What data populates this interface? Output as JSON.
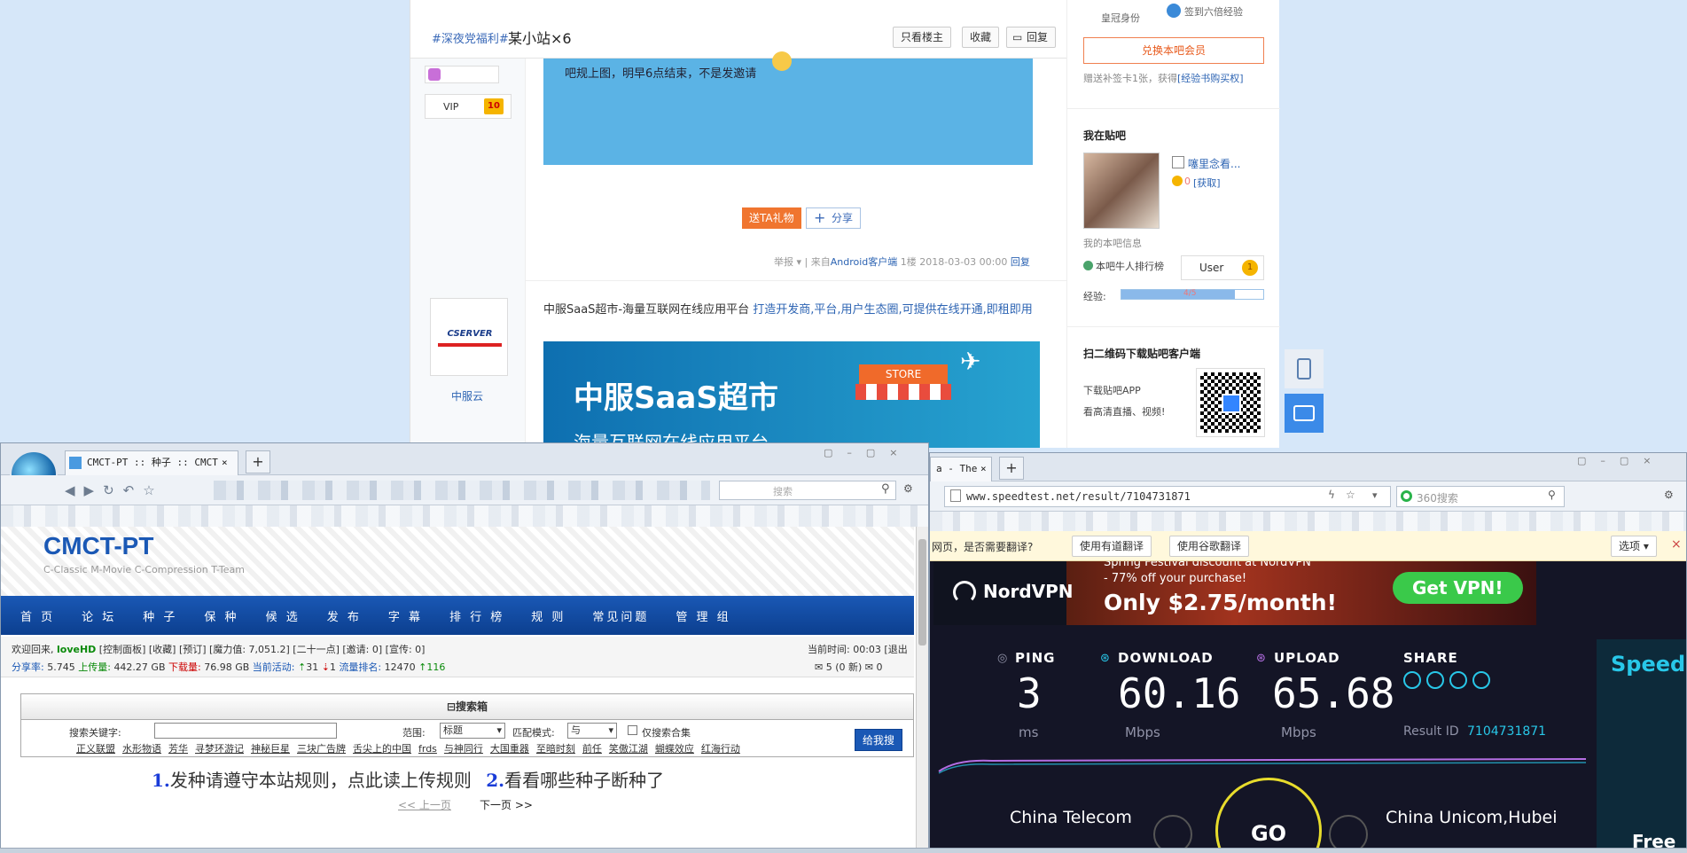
{
  "tieba": {
    "post": {
      "tag": "#深夜党福利#",
      "title": "某小站×6",
      "btn_louzhu": "只看楼主",
      "btn_fav": "收藏",
      "btn_reply": "回复",
      "vip_label": "VIP",
      "vip_level": "10",
      "image_text": "吧规上图，明早6点结束，不是发邀请",
      "gift_btn": "送TA礼物",
      "share_btn": "分享",
      "meta_report": "举报",
      "meta_from": "| 来自",
      "meta_client": "Android客户端",
      "meta_floor": "1楼",
      "meta_time": "2018-03-03 00:00",
      "meta_reply": "回复"
    },
    "ad": {
      "author": "中服云",
      "logo_text": "CSERVER",
      "text_plain": "中服SaaS超市-海量互联网在线应用平台 ",
      "text_link": "打造开发商,平台,用户生态圈,可提供在线开通,即租即用",
      "banner_title": "中服SaaS超市",
      "banner_sub": "海量互联网在线应用平台",
      "store": "STORE"
    },
    "side": {
      "role": "皇冠身份",
      "sign": "签到六倍经验",
      "member_btn": "兑换本吧会员",
      "card_text": "赠送补签卡1张，获得",
      "card_link": "[经验书购买权]",
      "my_title": "我在贴吧",
      "username": "噻里念看...",
      "tbean": "0",
      "tbean_link": "[获取]",
      "my_info": "我的本吧信息",
      "rank_label": "本吧牛人排行榜",
      "rank_user": "User",
      "rank_num": "1",
      "exp_label": "经验:",
      "exp_value": "4/5",
      "exp_fraction": 0.8,
      "qr_title": "扫二维码下载贴吧客户端",
      "qr_line1": "下载贴吧APP",
      "qr_line2": "看高清直播、视频!"
    }
  },
  "cmct": {
    "tab_title": "CMCT-PT :: 种子 :: CMCT",
    "tab_close": "×",
    "new_tab": "+",
    "search_placeholder": "搜索",
    "logo": "CMCT-PT",
    "slogan": "C-Classic M-Movie C-Compression T-Team",
    "nav": [
      "首 页",
      "论 坛",
      "种 子",
      "保 种",
      "候 选",
      "发 布",
      "字 幕",
      "排 行 榜",
      "规 则",
      "常见问题",
      "管 理 组"
    ],
    "welcome": "欢迎回来, ",
    "user": "loveHD",
    "welcome_rest": " [控制面板] [收藏] [预订] [魔力值: 7,051.2] [二十一点] [邀请: 0] [宣传: 0]",
    "time": "当前时间: 00:03 [退出",
    "ratio_label": "分享率:",
    "ratio": "5.745",
    "up_label": "上传量:",
    "up": "442.27 GB",
    "down_label": "下载量:",
    "down": "76.98 GB",
    "active_label": "当前活动:",
    "active_up": "31",
    "active_down": "1",
    "rank_label": "流量排名:",
    "rank": "12470",
    "rank_delta": "116",
    "msg": "5 (0 新)",
    "msg2": "0",
    "searchbox_title": "搜索箱",
    "kw_label": "搜索关键字:",
    "scope_label": "范围:",
    "scope": "标题",
    "mode_label": "匹配模式:",
    "mode": "与",
    "only_collection": "仅搜索合集",
    "search_btn": "给我搜",
    "tags": [
      "正义联盟",
      "水形物语",
      "芳华",
      "寻梦环游记",
      "神秘巨星",
      "三块广告牌",
      "舌尖上的中国",
      "frds",
      "与神同行",
      "大国重器",
      "至暗时刻",
      "前任",
      "笑傲江湖",
      "蝴蝶效应",
      "红海行动"
    ],
    "notice_num1": "1.",
    "notice1": "发种请遵守本站规则，点此读上传规则",
    "notice_num2": "2.",
    "notice2": "看看哪些种子断种了",
    "prev": "<< 上一页",
    "next": "下一页 >>"
  },
  "speedtest": {
    "tab_title": "a - The",
    "tab_close": "×",
    "new_tab": "+",
    "url": "www.speedtest.net/result/7104731871",
    "search_placeholder": "360搜索",
    "translate_q": "网页，是否需要翻译?",
    "youdao": "使用有道翻译",
    "google": "使用谷歌翻译",
    "options": "选项",
    "close": "×",
    "ad_brand": "NordVPN",
    "ad_line1": "Spring Festival discount at NordVPN",
    "ad_line2": "- 77% off your purchase!",
    "ad_price": "Only $2.75/month!",
    "ad_cta": "Get VPN!",
    "ping_label": "PING",
    "ping": "3",
    "ping_unit": "ms",
    "down_label": "DOWNLOAD",
    "down": "60.16",
    "down_unit": "Mbps",
    "up_label": "UPLOAD",
    "up": "65.68",
    "up_unit": "Mbps",
    "share_label": "SHARE",
    "result_label": "Result ID",
    "result_id": "7104731871",
    "isp": "China Telecom",
    "go": "GO",
    "server": "China Unicom,Hubei",
    "side_brand": "Speed",
    "side_free": "Free"
  },
  "colors": {
    "accent": "#1a58b5",
    "tieba_blue": "#5bb3e5",
    "st_bg": "#141526",
    "st_cyan": "#28c7e8",
    "st_purple": "#b46ee3"
  }
}
